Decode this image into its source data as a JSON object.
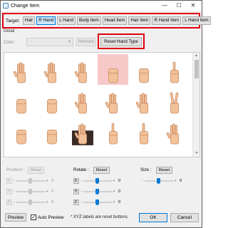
{
  "window": {
    "title": "Change Item",
    "controls": [
      "—",
      "☐",
      "✕"
    ]
  },
  "target": {
    "label": "Target:",
    "buttons": [
      "Hair",
      "R Hand",
      "L Hand",
      "Body Item",
      "Head Item",
      "Hair Item",
      "R Hand Item",
      "L Hand Item"
    ],
    "active": "R Hand"
  },
  "detail": {
    "label": "Detail",
    "color_label": "Color :",
    "color_value": "▾",
    "remove_label": "Remove",
    "reset_hand_type_label": "Reset Hand Type"
  },
  "grid": {
    "icon_names": [
      "flat-hand",
      "raised-palm",
      "spread-palm",
      "fist-selected",
      "curled-hand",
      "point-hand",
      "half-fist",
      "fist",
      "relaxed-hand",
      "pinch-hand",
      "wave-hand",
      "victory-hand",
      "fist-side",
      "fist-thumb",
      "dark-sleeve-hand",
      "pinch-up",
      "thumb-up",
      "open-hand"
    ],
    "selected_index": 3,
    "colors": {
      "skin": "#f2c29a",
      "skin_line": "#c98a62",
      "selected_bg": "#f6c8c8",
      "dark_sleeve": "#3a2a26"
    }
  },
  "transform": {
    "position_label": "Position :",
    "position_reset": "Reset",
    "rotate_label": "Rotate :",
    "rotate_reset": "Reset",
    "size_label": "Size :",
    "size_reset": "Reset",
    "axes": [
      "X:",
      "Y:",
      "Z:"
    ],
    "position_values": [
      "0",
      "0",
      "0"
    ],
    "rotate_values": [
      "0",
      "0",
      "0"
    ],
    "size_values": [
      "0"
    ],
    "minus": "-",
    "plus": "+"
  },
  "footer": {
    "preview_label": "Preview",
    "auto_preview_label": "Auto Preview",
    "auto_preview_checked": "✓",
    "note": "* XYZ labels are reset buttons.",
    "ok_label": "OK",
    "cancel_label": "Cancel"
  }
}
